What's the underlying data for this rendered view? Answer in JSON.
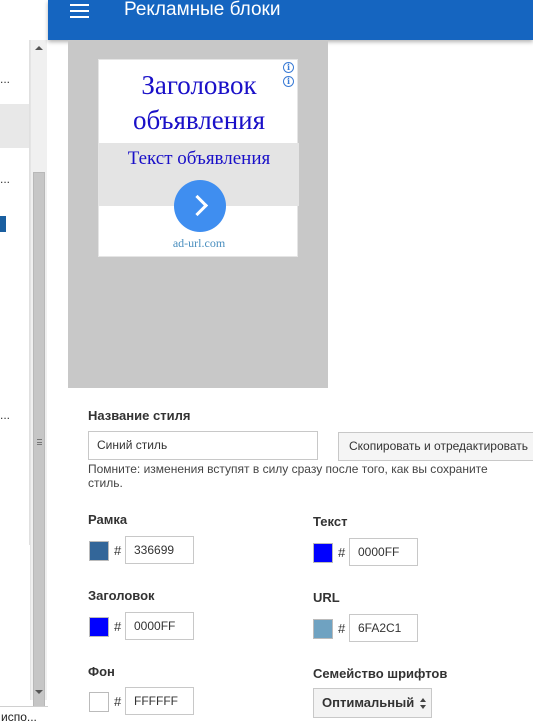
{
  "header": {
    "title": "Рекламные блоки",
    "menu_icon": "hamburger-menu-icon",
    "background": "#1565c0"
  },
  "sidebar": {
    "items": [
      {
        "label": "..."
      },
      {
        "label": ""
      },
      {
        "label": "..."
      },
      {
        "label": "..."
      },
      {
        "label": "..."
      }
    ],
    "bottom_label": "испо..."
  },
  "preview": {
    "headline": "Заголовок объявления",
    "text": "Текст объявления",
    "url": "ad-url.com",
    "info_icon": "i",
    "background": "#c8c8c8"
  },
  "form": {
    "style_name_label": "Название стиля",
    "style_name_value": "Синий стиль",
    "copy_button": "Скопировать и отредактировать",
    "note": "Помните: изменения вступят в силу сразу после того, как вы сохраните стиль.",
    "hash": "#",
    "colors": {
      "border": {
        "label": "Рамка",
        "value": "336699",
        "color": "#336699"
      },
      "text": {
        "label": "Текст",
        "value": "0000FF",
        "color": "#0000FF"
      },
      "title": {
        "label": "Заголовок",
        "value": "0000FF",
        "color": "#0000FF"
      },
      "url": {
        "label": "URL",
        "value": "6FA2C1",
        "color": "#6FA2C1"
      },
      "background": {
        "label": "Фон",
        "value": "FFFFFF",
        "color": "#FFFFFF"
      }
    },
    "font_family": {
      "label": "Семейство шрифтов",
      "value": "Оптимальный"
    }
  }
}
